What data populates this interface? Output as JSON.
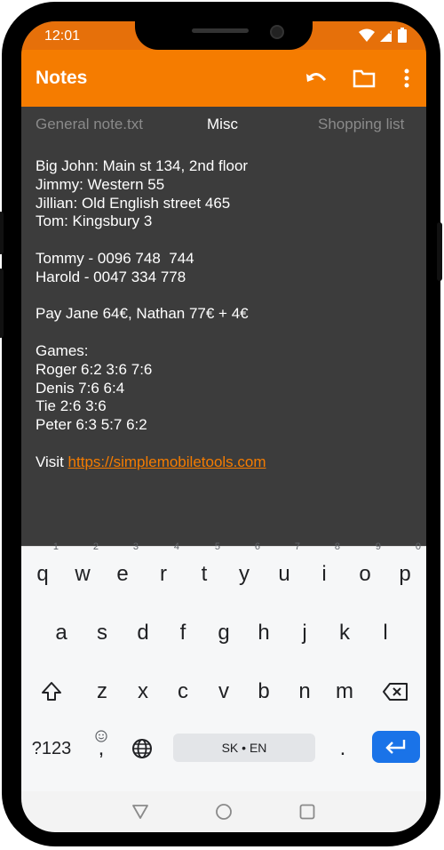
{
  "status_bar": {
    "time": "12:01"
  },
  "app": {
    "title": "Notes"
  },
  "tabs": [
    {
      "label": "General note.txt"
    },
    {
      "label": "Misc"
    },
    {
      "label": "Shopping list"
    }
  ],
  "note": {
    "lines": [
      "Big John: Main st 134, 2nd floor",
      "Jimmy: Western 55",
      "Jillian: Old English street 465",
      "Tom: Kingsbury 3",
      "",
      "Tommy - 0096 748  744",
      "Harold - 0047 334 778",
      "",
      "Pay Jane 64€, Nathan 77€ + 4€",
      "",
      "Games:",
      "Roger 6:2 3:6 7:6",
      "Denis 7:6 6:4",
      "Tie 2:6 3:6",
      "Peter 6:3 5:7 6:2",
      ""
    ],
    "visit_label": "Visit ",
    "link": "https://simplemobiletools.com"
  },
  "keyboard": {
    "row1": [
      {
        "key": "q",
        "hint": "1"
      },
      {
        "key": "w",
        "hint": "2"
      },
      {
        "key": "e",
        "hint": "3"
      },
      {
        "key": "r",
        "hint": "4"
      },
      {
        "key": "t",
        "hint": "5"
      },
      {
        "key": "y",
        "hint": "6"
      },
      {
        "key": "u",
        "hint": "7"
      },
      {
        "key": "i",
        "hint": "8"
      },
      {
        "key": "o",
        "hint": "9"
      },
      {
        "key": "p",
        "hint": "0"
      }
    ],
    "row2": [
      "a",
      "s",
      "d",
      "f",
      "g",
      "h",
      "j",
      "k",
      "l"
    ],
    "row3": [
      "z",
      "x",
      "c",
      "v",
      "b",
      "n",
      "m"
    ],
    "symbols_label": "?123",
    "comma_label": ",",
    "space_label": "SK • EN",
    "period_label": "."
  },
  "colors": {
    "accent": "#f57c00",
    "status_bar": "#e6700a",
    "background": "#3c3c3c",
    "enter_key": "#1a73e8"
  },
  "icons": [
    "undo-icon",
    "folder-icon",
    "more-vert-icon",
    "wifi-icon",
    "signal-icon",
    "battery-icon",
    "shift-icon",
    "backspace-icon",
    "emoji-icon",
    "globe-icon",
    "enter-icon",
    "nav-back-icon",
    "nav-home-icon",
    "nav-recents-icon"
  ]
}
